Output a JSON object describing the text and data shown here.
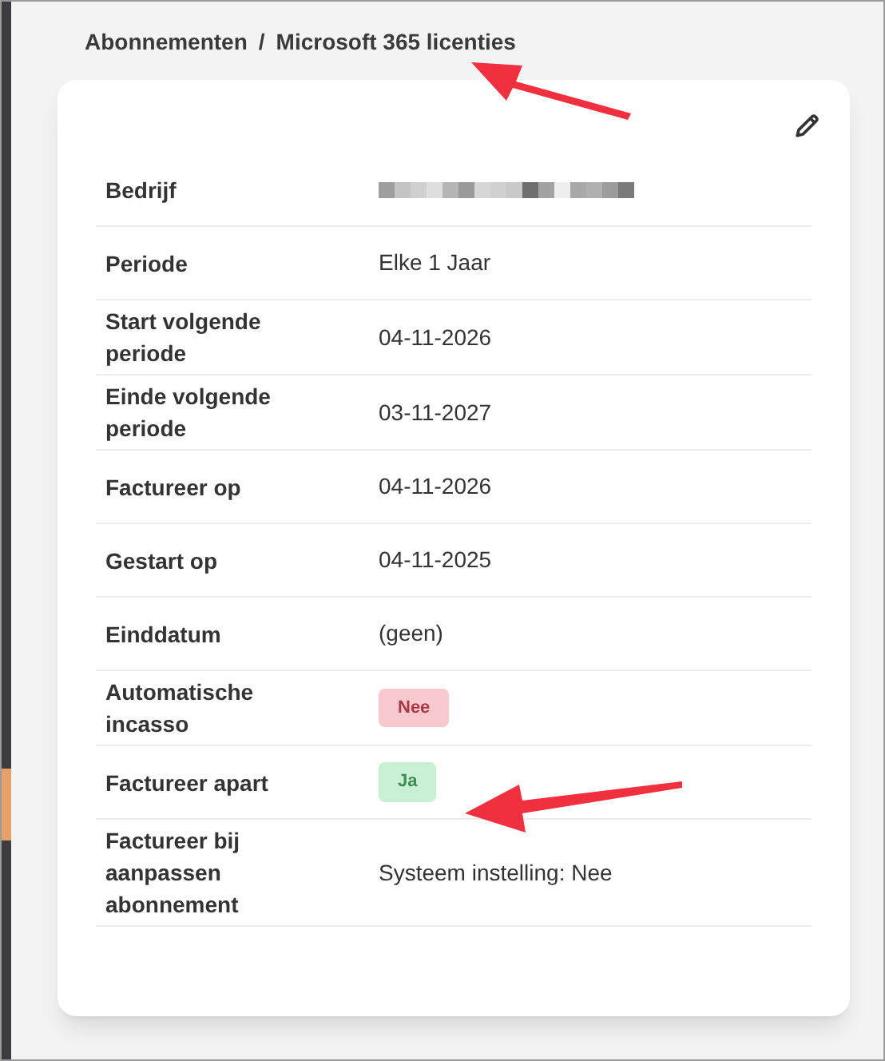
{
  "breadcrumb": [
    {
      "label": "Abonnementen"
    },
    {
      "label": "/"
    },
    {
      "label": "Microsoft 365 licenties"
    }
  ],
  "details": [
    {
      "label": "Bedrijf",
      "kind": "redacted"
    },
    {
      "label": "Periode",
      "kind": "text",
      "value": "Elke 1 Jaar"
    },
    {
      "label": "Start volgende periode",
      "kind": "text",
      "value": "04-11-2026"
    },
    {
      "label": "Einde volgende periode",
      "kind": "text",
      "value": "03-11-2027"
    },
    {
      "label": "Factureer op",
      "kind": "text",
      "value": "04-11-2026"
    },
    {
      "label": "Gestart op",
      "kind": "text",
      "value": "04-11-2025"
    },
    {
      "label": "Einddatum",
      "kind": "text",
      "value": "(geen)"
    },
    {
      "label": "Automatische incasso",
      "kind": "badge",
      "value": "Nee",
      "on": false
    },
    {
      "label": "Factureer apart",
      "kind": "badge",
      "value": "Ja",
      "on": true
    },
    {
      "label": "Factureer bij aanpassen abonnement",
      "kind": "text",
      "value": "Systeem instelling: Nee"
    }
  ]
}
